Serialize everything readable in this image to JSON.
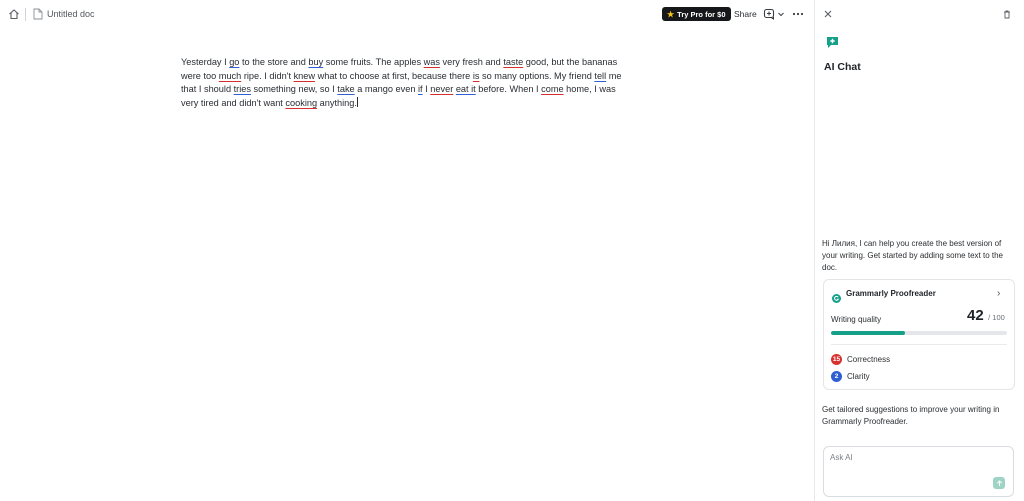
{
  "document": {
    "title": "Untitled doc",
    "body": [
      {
        "t": "Yesterday I "
      },
      {
        "t": "go",
        "u": "blue"
      },
      {
        "t": " to the store and "
      },
      {
        "t": "buy",
        "u": "blue"
      },
      {
        "t": " some fruits. The apples "
      },
      {
        "t": "was",
        "u": "red"
      },
      {
        "t": " very fresh and "
      },
      {
        "t": "taste",
        "u": "red"
      },
      {
        "t": " good, but the bananas were too "
      },
      {
        "t": "much",
        "u": "red"
      },
      {
        "t": " ripe. I didn't "
      },
      {
        "t": "knew",
        "u": "red"
      },
      {
        "t": " what to choose at first, because there "
      },
      {
        "t": "is",
        "u": "red"
      },
      {
        "t": " so many options. My friend "
      },
      {
        "t": "tell",
        "u": "blue"
      },
      {
        "t": " me that I should "
      },
      {
        "t": "tries",
        "u": "blue"
      },
      {
        "t": " something new, so I "
      },
      {
        "t": "take",
        "u": "blue"
      },
      {
        "t": " a mango even "
      },
      {
        "t": "if",
        "u": "blue"
      },
      {
        "t": " I "
      },
      {
        "t": "never",
        "u": "red"
      },
      {
        "t": " "
      },
      {
        "t": "eat it",
        "u": "blue"
      },
      {
        "t": " before. When I "
      },
      {
        "t": "come",
        "u": "red"
      },
      {
        "t": " home, I was very tired and didn't want "
      },
      {
        "t": "cooking",
        "u": "red"
      },
      {
        "t": " anything."
      }
    ]
  },
  "toolbar": {
    "try_pro": "Try Pro for $0",
    "share": "Share"
  },
  "panel": {
    "title": "AI Chat",
    "greeting": "Hi Лилия, I can help you create the best version of your writing. Get started by adding some text to the doc.",
    "proofreader": {
      "name": "Grammarly Proofreader",
      "writing_quality_label": "Writing quality",
      "score": "42",
      "score_max": "/ 100",
      "progress_fraction": 0.42,
      "correctness_count": "15",
      "correctness_label": "Correctness",
      "clarity_count": "2",
      "clarity_label": "Clarity"
    },
    "tailored": "Get tailored suggestions to improve your writing in Grammarly Proofreader.",
    "ask_placeholder": "Ask AI"
  },
  "colors": {
    "accent": "#15a08a",
    "correctness": "#d8322e",
    "clarity": "#2f5fd0"
  }
}
